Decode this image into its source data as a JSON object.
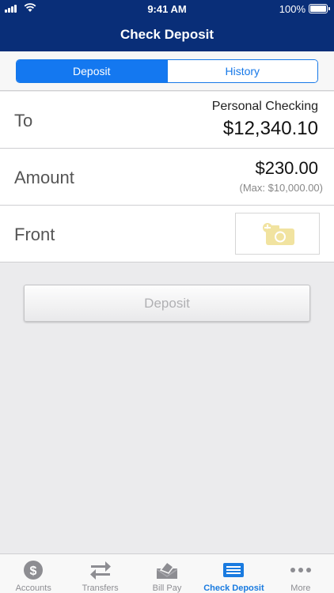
{
  "status_bar": {
    "time": "9:41 AM",
    "battery": "100%"
  },
  "header": {
    "title": "Check Deposit"
  },
  "segments": [
    {
      "label": "Deposit",
      "active": true
    },
    {
      "label": "History",
      "active": false
    }
  ],
  "form": {
    "to": {
      "label": "To",
      "account_name": "Personal Checking",
      "balance": "$12,340.10"
    },
    "amount": {
      "label": "Amount",
      "value": "$230.00",
      "max": "(Max: $10,000.00)"
    },
    "front": {
      "label": "Front",
      "icon": "add-camera-icon"
    }
  },
  "deposit_button": {
    "label": "Deposit"
  },
  "tabbar": [
    {
      "label": "Accounts",
      "icon": "dollar-coin-icon",
      "active": false
    },
    {
      "label": "Transfers",
      "icon": "transfer-arrows-icon",
      "active": false
    },
    {
      "label": "Bill Pay",
      "icon": "envelope-icon",
      "active": false
    },
    {
      "label": "Check Deposit",
      "icon": "check-icon",
      "active": true
    },
    {
      "label": "More",
      "icon": "more-dots-icon",
      "active": false
    }
  ],
  "colors": {
    "header": "#092e78",
    "accent": "#1478f0",
    "camera_icon": "#f1e3a0"
  }
}
